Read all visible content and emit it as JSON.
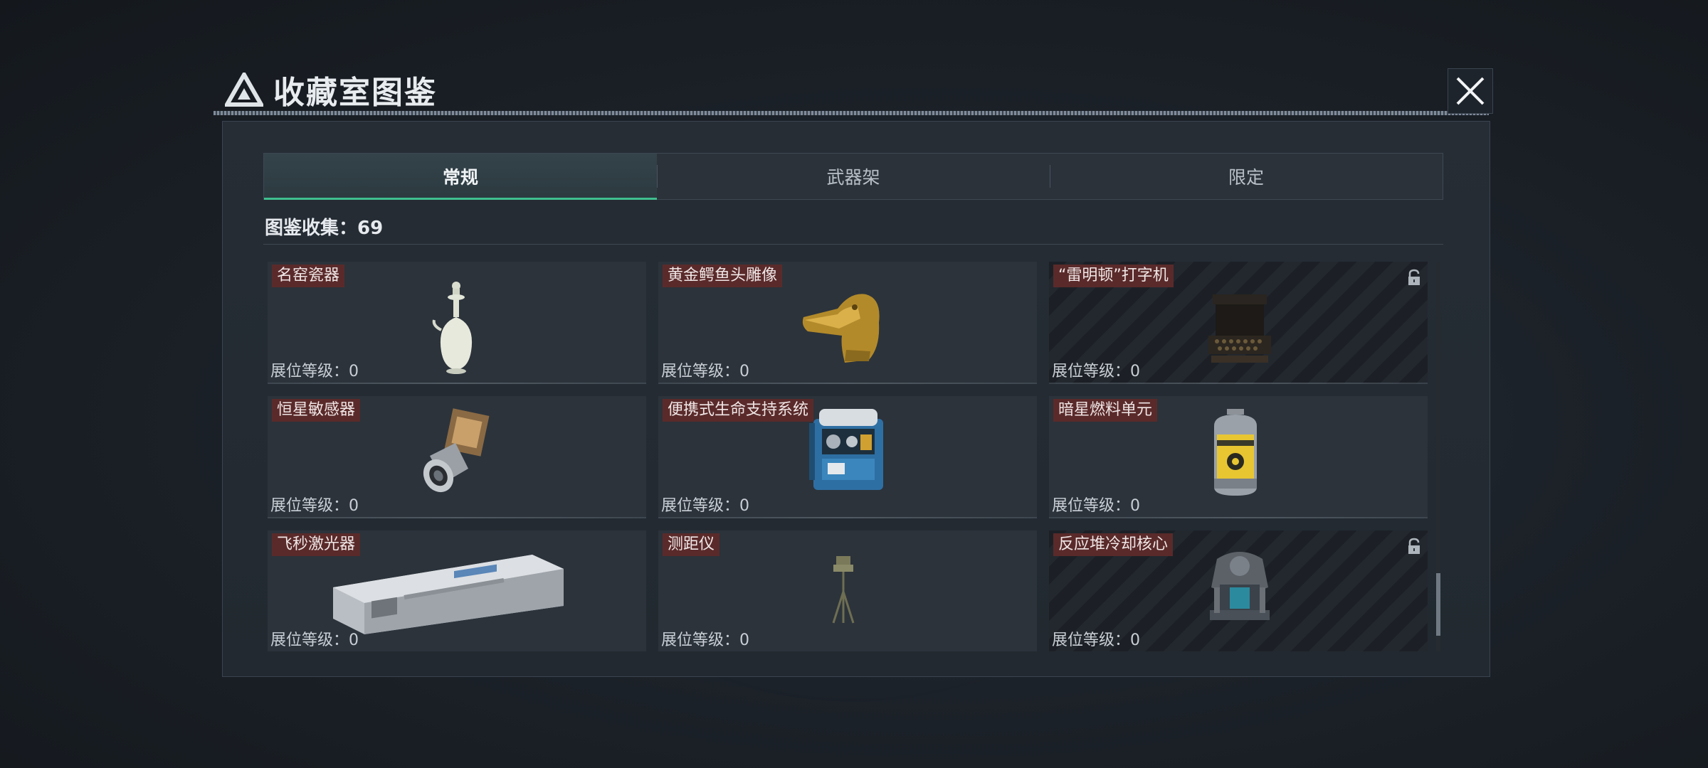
{
  "window": {
    "title": "收藏室图鉴"
  },
  "tabs": [
    {
      "label": "常规",
      "active": true
    },
    {
      "label": "武器架",
      "active": false
    },
    {
      "label": "限定",
      "active": false
    }
  ],
  "collection": {
    "label": "图鉴收集：69"
  },
  "items": [
    {
      "name": "名窑瓷器",
      "level": "展位等级：0",
      "locked": false,
      "icon": "porcelain-vase-icon"
    },
    {
      "name": "黄金鳄鱼头雕像",
      "level": "展位等级：0",
      "locked": false,
      "icon": "golden-crocodile-head-icon"
    },
    {
      "name": "“雷明顿”打字机",
      "level": "展位等级：0",
      "locked": true,
      "icon": "typewriter-icon"
    },
    {
      "name": "恒星敏感器",
      "level": "展位等级：0",
      "locked": false,
      "icon": "star-sensor-icon"
    },
    {
      "name": "便携式生命支持系统",
      "level": "展位等级：0",
      "locked": false,
      "icon": "life-support-icon"
    },
    {
      "name": "暗星燃料单元",
      "level": "展位等级：0",
      "locked": false,
      "icon": "fuel-canister-icon"
    },
    {
      "name": "飞秒激光器",
      "level": "展位等级：0",
      "locked": false,
      "icon": "laser-box-icon"
    },
    {
      "name": "测距仪",
      "level": "展位等级：0",
      "locked": false,
      "icon": "tripod-rangefinder-icon"
    },
    {
      "name": "反应堆冷却核心",
      "level": "展位等级：0",
      "locked": true,
      "icon": "reactor-core-icon"
    }
  ],
  "colors": {
    "accent": "#3fbf8f",
    "tag_bg": "#5a2a2a"
  }
}
